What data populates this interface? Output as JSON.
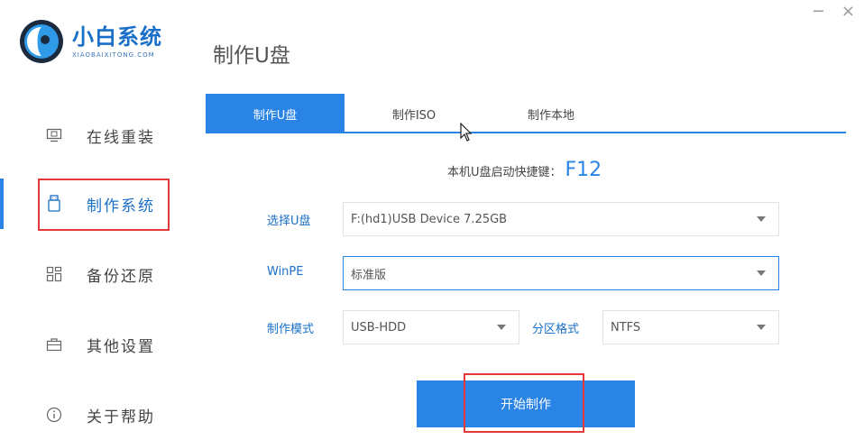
{
  "window": {
    "minimize": "−",
    "close": "×"
  },
  "logo": {
    "title": "小白系统",
    "subtitle": "XIAOBAIXITONG.COM"
  },
  "sidebar": {
    "items": [
      {
        "label": "在线重装",
        "icon": "monitor-icon",
        "active": false
      },
      {
        "label": "制作系统",
        "icon": "usb-drive-icon",
        "active": true
      },
      {
        "label": "备份还原",
        "icon": "grid-icon",
        "active": false
      },
      {
        "label": "其他设置",
        "icon": "briefcase-icon",
        "active": false
      },
      {
        "label": "关于帮助",
        "icon": "info-icon",
        "active": false
      }
    ]
  },
  "main": {
    "title": "制作U盘",
    "tabs": [
      {
        "label": "制作U盘",
        "active": true
      },
      {
        "label": "制作ISO",
        "active": false
      },
      {
        "label": "制作本地",
        "active": false
      }
    ],
    "hotkey": {
      "label": "本机U盘启动快捷键：",
      "value": "F12"
    },
    "form": {
      "usb_label": "选择U盘",
      "usb_value": "F:(hd1)USB Device 7.25GB",
      "winpe_label": "WinPE",
      "winpe_value": "标准版",
      "mode_label": "制作模式",
      "mode_value": "USB-HDD",
      "partition_label": "分区格式",
      "partition_value": "NTFS"
    },
    "start_button": "开始制作"
  },
  "colors": {
    "accent": "#2a84e6",
    "highlight": "#e23a3a"
  }
}
